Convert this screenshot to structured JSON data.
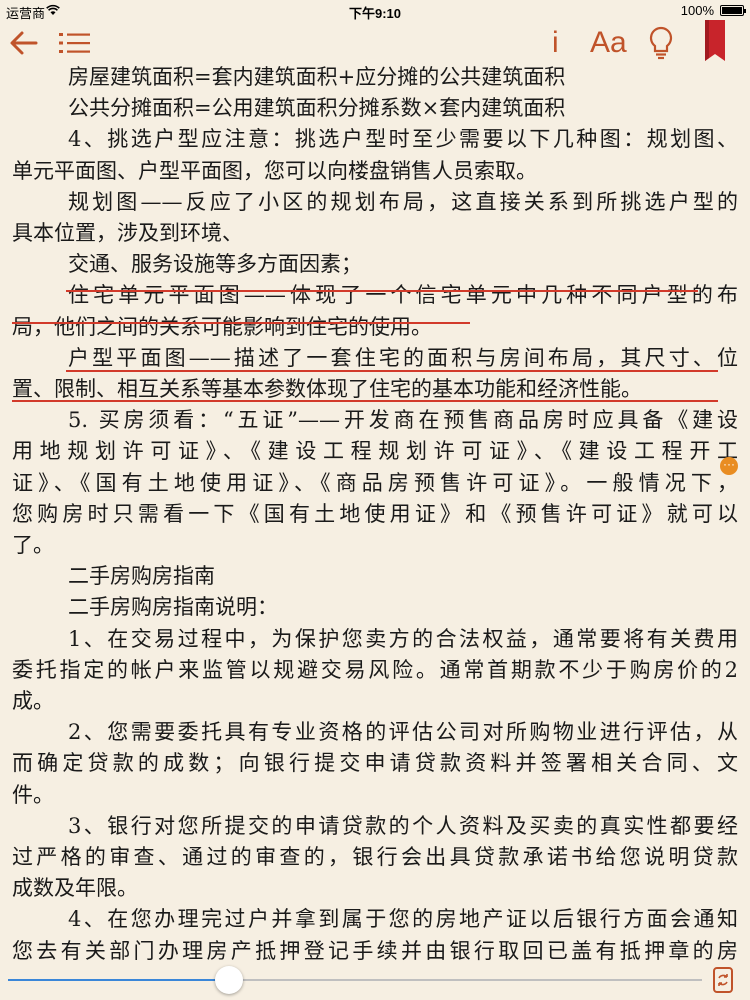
{
  "status": {
    "carrier": "运营商",
    "time": "下午9:10",
    "battery": "100%"
  },
  "toolbar": {
    "icons": [
      "back-arrow-icon",
      "toc-list-icon",
      "info-icon",
      "font-size-icon",
      "lightbulb-icon",
      "bookmark-icon"
    ],
    "info_label": "i",
    "font_label": "Aa",
    "accent_color": "#c0532a",
    "bookmark_color": "#c8242b"
  },
  "reader": {
    "lines": [
      "房屋建筑面积=套内建筑面积+应分摊的公共建筑面积",
      "公共分摊面积=公用建筑面积分摊系数×套内建筑面积",
      "4、挑选户型应注意：挑选户型时至少需要以下几种图：规划图、",
      "单元平面图、户型平面图，您可以向楼盘销售人员索取。",
      "规划图——反应了小区的规划布局，这直接关系到所挑选户型的",
      "具本位置，涉及到环境、",
      "交通、服务设施等多方面因素；",
      "住宅单元平面图——体现了一个信宅单元中几种不同户型的布",
      "局，他们之间的关系可能影响到住宅的使用。",
      "户型平面图——描述了一套住宅的面积与房间布局，其尺寸、位",
      "置、限制、相互关系等基本参数体现了住宅的基本功能和经济性能。",
      "5. 买房须看：“五证”——开发商在预售商品房时应具备《建设",
      "用地规划许可证》、《建设工程规划许可证》、《建设工程开工",
      "证》、《国有土地使用证》、《商品房预售许可证》。一般情况下，",
      "您购房时只需看一下《国有土地使用证》和《预售许可证》就可以",
      "了。",
      "二手房购房指南",
      "二手房购房指南说明：",
      "1、在交易过程中，为保护您卖方的合法权益，通常要将有关费用",
      "委托指定的帐户来监管以规避交易风险。通常首期款不少于购房价的2",
      "成。",
      "2、您需要委托具有专业资格的评估公司对所购物业进行评估，从",
      "而确定贷款的成数；向银行提交申请贷款资料并签署相关合同、文",
      "件。",
      "3、银行对您所提交的申请贷款的个人资料及买卖的真实性都要经",
      "过严格的审查、通过的审查的，银行会出具贷款承诺书给您说明贷款",
      "成数及年限。",
      "4、在您办理完过户并拿到属于您的房地产证以后银行方面会通知",
      "您去有关部门办理房产抵押登记手续并由银行取回已盖有抵押章的房"
    ],
    "underline_color": "#d23a2a",
    "note_marker_label": "···",
    "progress_fraction": 0.33,
    "progress_color": "#3a86d8"
  }
}
